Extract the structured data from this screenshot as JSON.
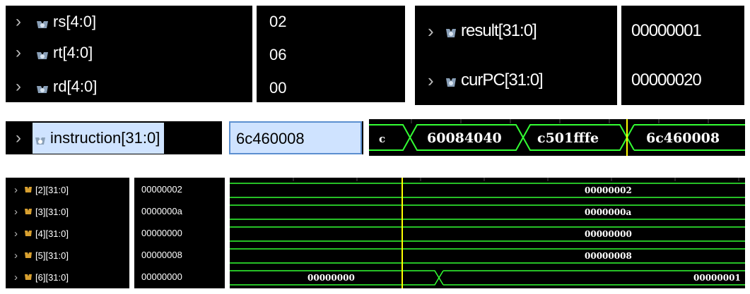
{
  "colors": {
    "wave": "#33ff33",
    "cursor": "#ffff00",
    "highlight": "#cfe3ff"
  },
  "top_panel_a": {
    "rows": [
      {
        "name": "rs[4:0]",
        "value": "02",
        "icon": "bus-signal-icon"
      },
      {
        "name": "rt[4:0]",
        "value": "06",
        "icon": "bus-signal-icon"
      },
      {
        "name": "rd[4:0]",
        "value": "00",
        "icon": "bus-signal-icon"
      }
    ]
  },
  "top_panel_b": {
    "rows": [
      {
        "name": "result[31:0]",
        "value": "00000001",
        "icon": "bus-signal-icon"
      },
      {
        "name": "curPC[31:0]",
        "value": "00000020",
        "icon": "bus-signal-icon"
      }
    ]
  },
  "instruction_panel": {
    "name": "instruction[31:0]",
    "value": "6c460008",
    "waveform": [
      "c",
      "60084040",
      "c501fffe",
      "6c460008"
    ]
  },
  "register_panel": {
    "rows": [
      {
        "name": "[2][31:0]",
        "value": "00000002",
        "wave": [
          "00000002"
        ]
      },
      {
        "name": "[3][31:0]",
        "value": "0000000a",
        "wave": [
          "0000000a"
        ]
      },
      {
        "name": "[4][31:0]",
        "value": "00000000",
        "wave": [
          "00000000"
        ]
      },
      {
        "name": "[5][31:0]",
        "value": "00000008",
        "wave": [
          "00000008"
        ]
      },
      {
        "name": "[6][31:0]",
        "value": "00000000",
        "wave": [
          "00000000",
          "00000001"
        ]
      }
    ]
  }
}
